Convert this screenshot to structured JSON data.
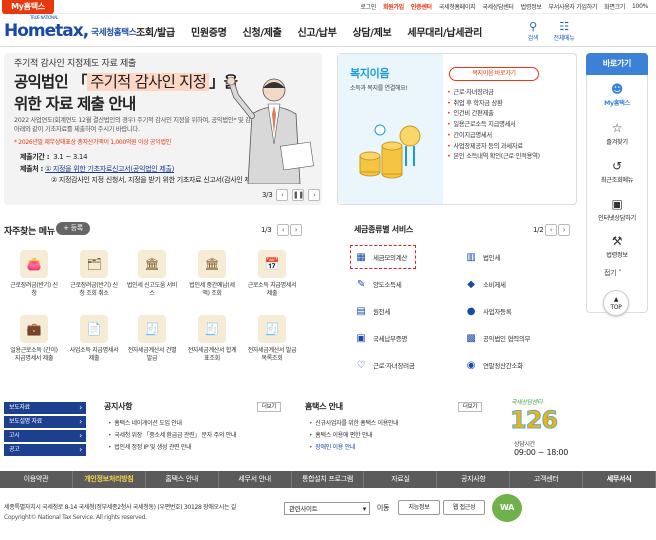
{
  "util": {
    "tab": "My홈택스",
    "links": [
      "로그인",
      "회원가입",
      "인증센터",
      "국세청홈페이지",
      "국세상담센터",
      "법령정보",
      "부서사용자 가입하기",
      "화면크기",
      "100%"
    ]
  },
  "header": {
    "logo_tag": "TRUE NATIONAL",
    "logo_main": "Hometax,",
    "logo_sub": "국세청홈택스",
    "gnb": [
      "조회/발급",
      "민원증명",
      "신청/제출",
      "신고/납부",
      "상담/제보",
      "세무대리/납세관리"
    ],
    "search": "검색",
    "all_menu": "전체메뉴"
  },
  "banner": {
    "sub": "주기적 감사인 지정제도 자료 제출",
    "title_a": "공익법인 「",
    "title_hl": "주기적 감사인 지정",
    "title_b": "」을",
    "title2": "위한 자료 제출 안내",
    "desc": "2022 사업연도(회계연도 12월 결산법인의 경우) 주기적 감사인 지정을 위하여, 공익법인* 및 감사인은 아래와 같이 기초자료를 제출하여 주시기 바랍니다.",
    "note": "* 2026년말 재무상태표상 총자산가액이 1,000억원 이상 공익법인",
    "period_label": "제출기간 :",
    "period": "3.1 ~ 3.14",
    "target_label": "제출처 :",
    "target1": "① 지정을 위한 기초자료신고서(공익법인 제출)",
    "target2": "② 지정감사인 지정 신청서, 지정을 받기 위한 기초자료 신고서(감사인 제출)",
    "pager": "3/3"
  },
  "welfare": {
    "title": "복지이음",
    "desc": "소득과 복지를 연결해요!",
    "button": "복지이음 바로가기",
    "items": [
      "근로·자녀장려금",
      "취업 후 학자금 상환",
      "인건비 간편제출",
      "일용근로소득 지급명세서",
      "간이지급명세서",
      "사업장제공자 등의 과세자료",
      "본인 소득내역 확인(근로·인적용역)"
    ]
  },
  "sidebar": {
    "head": "바로가기",
    "items": [
      "My홈택스",
      "즐겨찾기",
      "최근조회메뉴",
      "인터넷상담하기",
      "법령정보"
    ],
    "fold": "접기",
    "top": "TOP"
  },
  "freq": {
    "title": "자주찾는 메뉴",
    "btn": "+ 등록",
    "page": "1/3",
    "items": [
      {
        "label": "근로장려금(반기) 신청",
        "icon": "👛"
      },
      {
        "label": "근로장려금(반기) 신청 조회 취소",
        "icon": "🗂"
      },
      {
        "label": "법인세 신고도움 서비스",
        "icon": "🏛"
      },
      {
        "label": "법인세 중간예납(세액) 조회",
        "icon": "🏛"
      },
      {
        "label": "근로소득 지급명세서 제출",
        "icon": "📅"
      },
      {
        "label": "일용근로소득 (간이)지급명세서 제출",
        "icon": "💼"
      },
      {
        "label": "사업소득 지급명세서 제출",
        "icon": "📄"
      },
      {
        "label": "전자세금계산서 건별발급",
        "icon": "🧾"
      },
      {
        "label": "전자세금계산서 합계표조회",
        "icon": "🧾"
      },
      {
        "label": "전자세금계산서 발급목록조회",
        "icon": "🧾"
      }
    ]
  },
  "tax": {
    "title": "세금종류별 서비스",
    "page": "1/2",
    "items": [
      {
        "label": "세금모의계산",
        "icon": "▦"
      },
      {
        "label": "법인세",
        "icon": "▥"
      },
      {
        "label": "양도소득세",
        "icon": "✎"
      },
      {
        "label": "소비제세",
        "icon": "◆"
      },
      {
        "label": "원천세",
        "icon": "▤"
      },
      {
        "label": "사업자등록",
        "icon": "●"
      },
      {
        "label": "국세납부증명",
        "icon": "▣"
      },
      {
        "label": "공익법인 협력의무",
        "icon": "▩"
      },
      {
        "label": "근로·자녀장려금",
        "icon": "♡"
      },
      {
        "label": "연말정산간소화",
        "icon": "◉"
      }
    ]
  },
  "bottom_menu": [
    "보도자료",
    "보도설명 자료",
    "고시",
    "공고"
  ],
  "notice": {
    "title": "공지사항",
    "more": "더보기",
    "items": [
      "홈택스 네이게이션 도입 안내",
      "국세청 위장 「중소세 환급금 관련」 문자 주의 안내",
      "법인세 정정 IP 및 생성 관련 안내"
    ]
  },
  "guide": {
    "title": "홈택스 안내",
    "more": "더보기",
    "items": [
      "신규사업자를 위한 홈택스 이용안내",
      "홈택스 이용에 편한 안내",
      "장애인 이용 안내"
    ]
  },
  "call": {
    "label": "국세상담센터",
    "number": "126",
    "time_label": "상담시간",
    "time": "09:00 ~ 18:00"
  },
  "footnav": [
    "이용약관",
    "개인정보처리방침",
    "홈택스 안내",
    "세무서 안내",
    "통합설치 프로그램",
    "자료실",
    "공지사항",
    "고객센터",
    "세무서식"
  ],
  "footer": {
    "addr": "세종특별자치시 국세청로 8-14 국세청(정부세종2청사 국세청동) (우편번호) 30128  장애오시는 길",
    "copy": "Copyright© National Tax Service. All rights reserved.",
    "family": "관련사이트",
    "go": "이동",
    "wa1": "지능정보",
    "wa2": "웹 접근성",
    "wa_logo": "WA"
  }
}
